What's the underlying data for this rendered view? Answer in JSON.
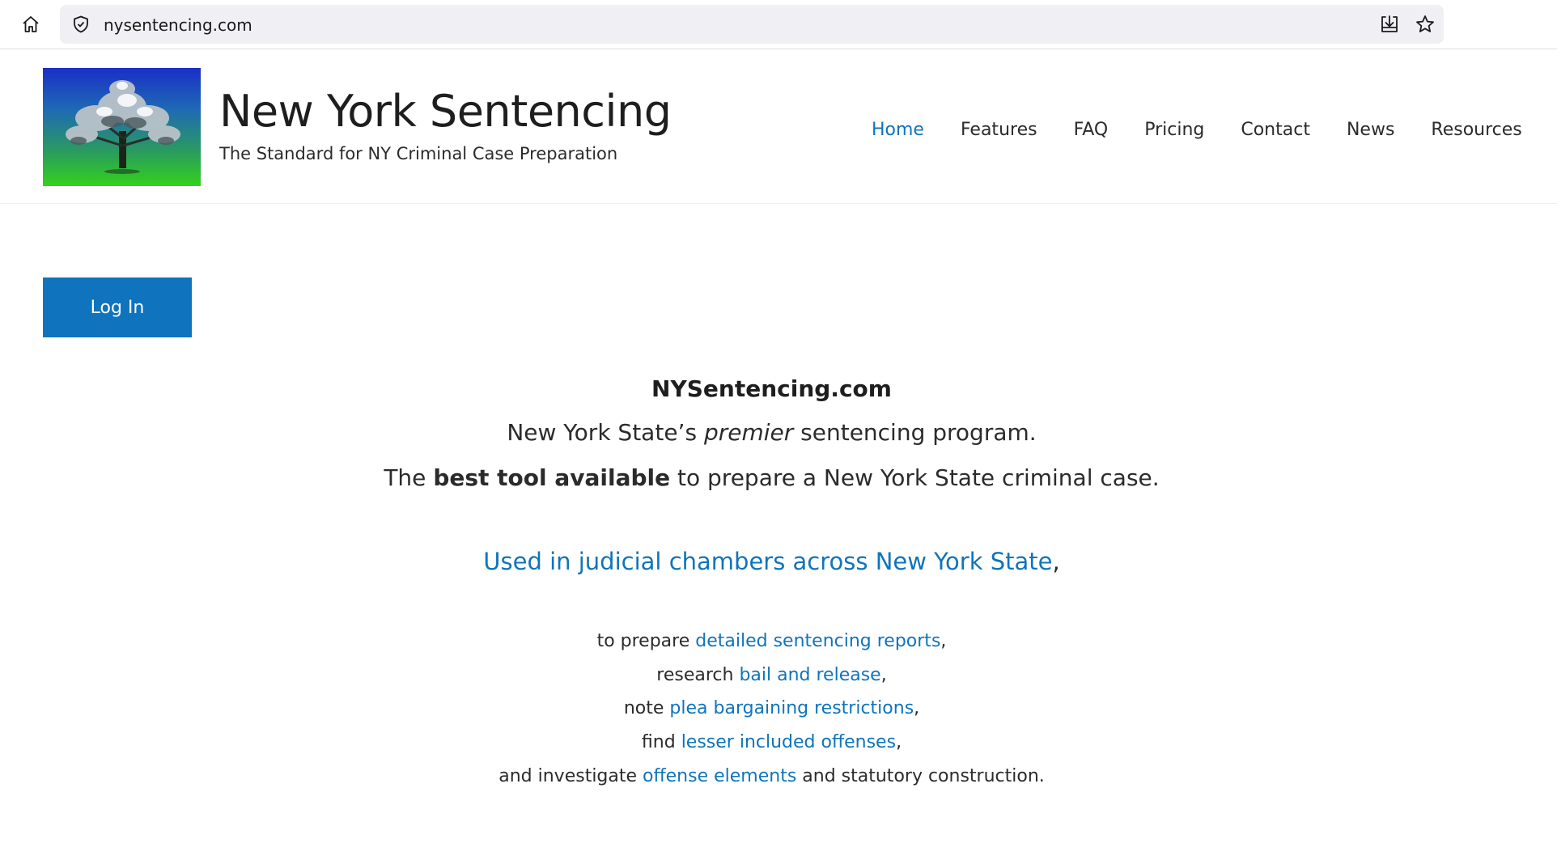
{
  "browser": {
    "url": "nysentencing.com"
  },
  "header": {
    "title": "New York Sentencing",
    "tagline": "The Standard for NY Criminal Case Preparation",
    "nav": [
      "Home",
      "Features",
      "FAQ",
      "Pricing",
      "Contact",
      "News",
      "Resources"
    ],
    "active_nav": "Home"
  },
  "main": {
    "login_label": "Log In",
    "brand": "NYSentencing.com",
    "line1": {
      "pre": "New York State’s ",
      "em": "premier",
      "post": " sentencing program."
    },
    "line2": {
      "pre": "The ",
      "strong": "best tool available",
      "post": " to prepare a New York State criminal case."
    },
    "line3": {
      "link": "Used in judicial chambers across New York State",
      "post": ","
    },
    "uses": [
      {
        "pre": "to prepare ",
        "link": "detailed sentencing reports",
        "post": ","
      },
      {
        "pre": "research ",
        "link": "bail and release",
        "post": ","
      },
      {
        "pre": "note ",
        "link": "plea bargaining restrictions",
        "post": ","
      },
      {
        "pre": "find ",
        "link": "lesser included offenses",
        "post": ","
      },
      {
        "pre": "and investigate ",
        "link": "offense elements",
        "post": " and statutory construction."
      }
    ]
  },
  "colors": {
    "link": "#1074bb",
    "button": "#0f73be",
    "logo_top": "#1a2fc6",
    "logo_bottom": "#34d21c"
  },
  "icons": [
    "home-icon",
    "shield-icon",
    "download-icon",
    "star-icon",
    "tree-logo-icon"
  ]
}
